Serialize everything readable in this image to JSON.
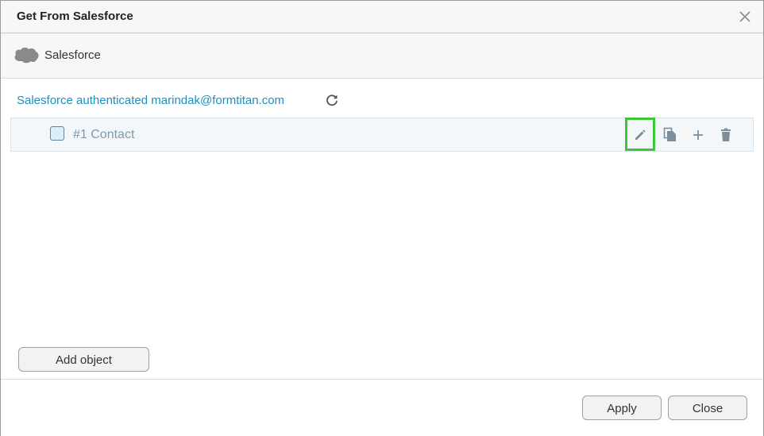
{
  "dialog": {
    "title": "Get From Salesforce"
  },
  "source": {
    "name": "Salesforce",
    "logo_text": "salesforce"
  },
  "auth": {
    "status_text": "Salesforce authenticated marindak@formtitan.com"
  },
  "objects": [
    {
      "label": "#1 Contact",
      "checked": false
    }
  ],
  "row_actions": [
    "edit-icon",
    "copy-icon",
    "plus-icon",
    "trash-icon"
  ],
  "buttons": {
    "add_object": "Add object",
    "apply": "Apply",
    "close": "Close"
  },
  "colors": {
    "accent_link": "#1e8fbf",
    "highlight": "#3dc735",
    "icon": "#7a8e9c"
  }
}
